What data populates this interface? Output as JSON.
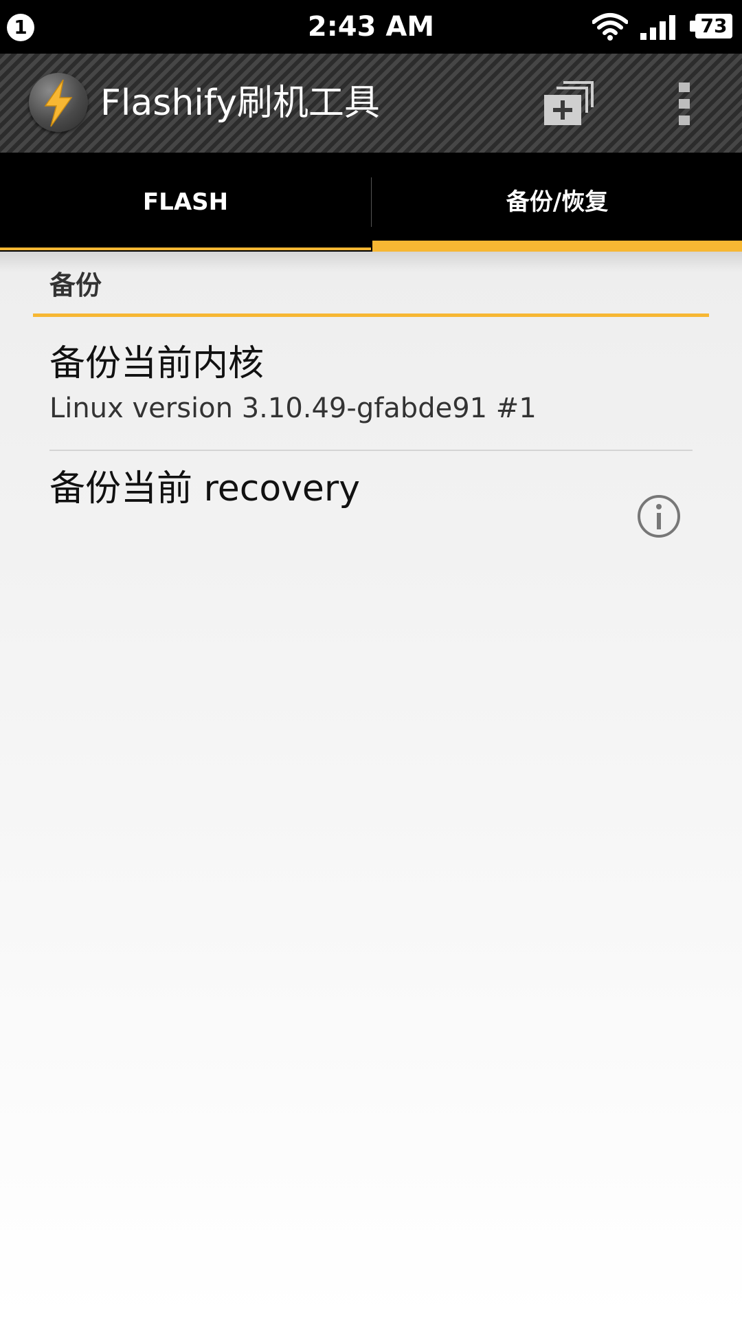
{
  "status_bar": {
    "notification_count": "1",
    "time": "2:43 AM",
    "battery": "73",
    "icons": [
      "wifi-icon",
      "signal-icon",
      "battery-icon"
    ]
  },
  "action_bar": {
    "title": "Flashify刷机工具",
    "icons": [
      "flash-logo-icon",
      "add-window-icon",
      "overflow-menu-icon"
    ]
  },
  "tabs": [
    {
      "label": "FLASH",
      "selected": false
    },
    {
      "label": "备份/恢复",
      "selected": true
    }
  ],
  "section": {
    "header": "备份",
    "items": [
      {
        "title": "备份当前内核",
        "subtitle": "Linux version 3.10.49-gfabde91 #1"
      },
      {
        "title": "备份当前 recovery"
      }
    ]
  },
  "colors": {
    "accent": "#f7b733",
    "status_bar": "#000000",
    "tab_bar": "#000000"
  }
}
